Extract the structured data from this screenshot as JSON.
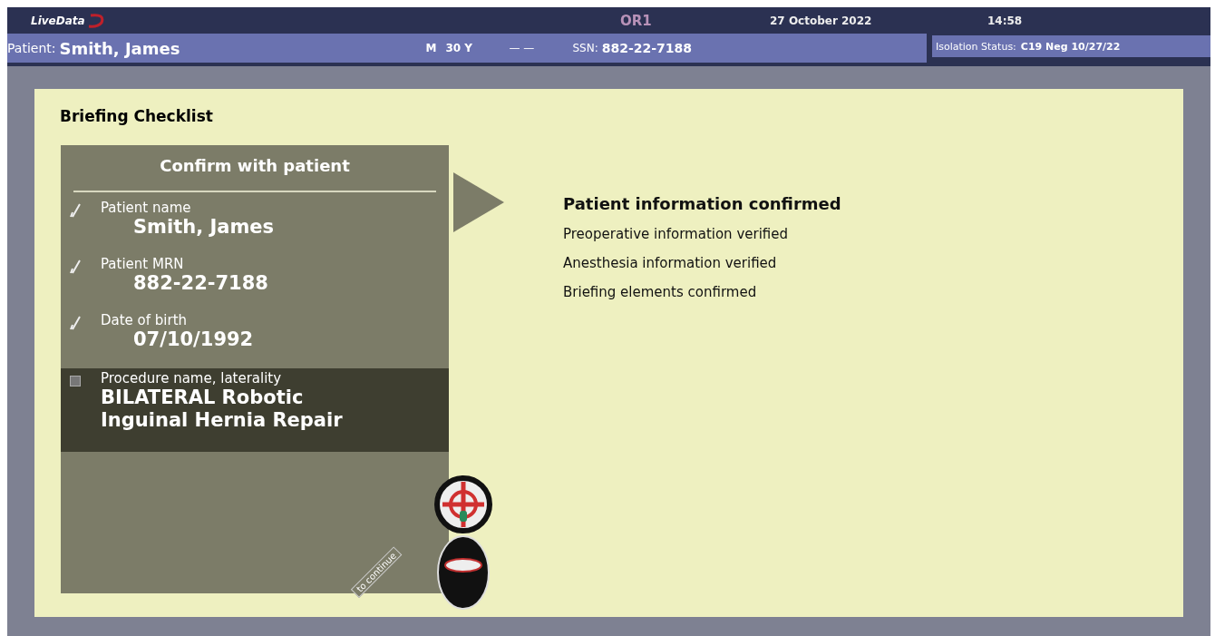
{
  "header": {
    "logo": "LiveData",
    "room": "OR1",
    "date": "27 October 2022",
    "time": "14:58"
  },
  "patient": {
    "label": "Patient:",
    "name": "Smith, James",
    "sex": "M",
    "age": "30 Y",
    "field_3": "— —",
    "ssn_label": "SSN:",
    "ssn": "882-22-7188"
  },
  "isolation": {
    "label": "Isolation Status:",
    "value": "C19 Neg 10/27/22"
  },
  "briefing": {
    "title": "Briefing Checklist",
    "panel_title": "Confirm with patient",
    "items": [
      {
        "label": "Patient name",
        "value": "Smith, James",
        "checked": true,
        "selected": false
      },
      {
        "label": "Patient MRN",
        "value": "882-22-7188",
        "checked": true,
        "selected": false
      },
      {
        "label": "Date of birth",
        "value": "07/10/1992",
        "checked": true,
        "selected": false
      },
      {
        "label": "Procedure name, laterality",
        "value": "BILATERAL Robotic Inguinal Hernia Repair",
        "checked": false,
        "selected": true
      }
    ],
    "steps": [
      {
        "text": "Patient information confirmed",
        "kind": "current"
      },
      {
        "text": "Preoperative information verified",
        "kind": "pending"
      },
      {
        "text": "Anesthesia information verified",
        "kind": "pending"
      },
      {
        "text": "Briefing elements confirmed",
        "kind": "pending"
      }
    ],
    "continue_hint": "to continue"
  }
}
